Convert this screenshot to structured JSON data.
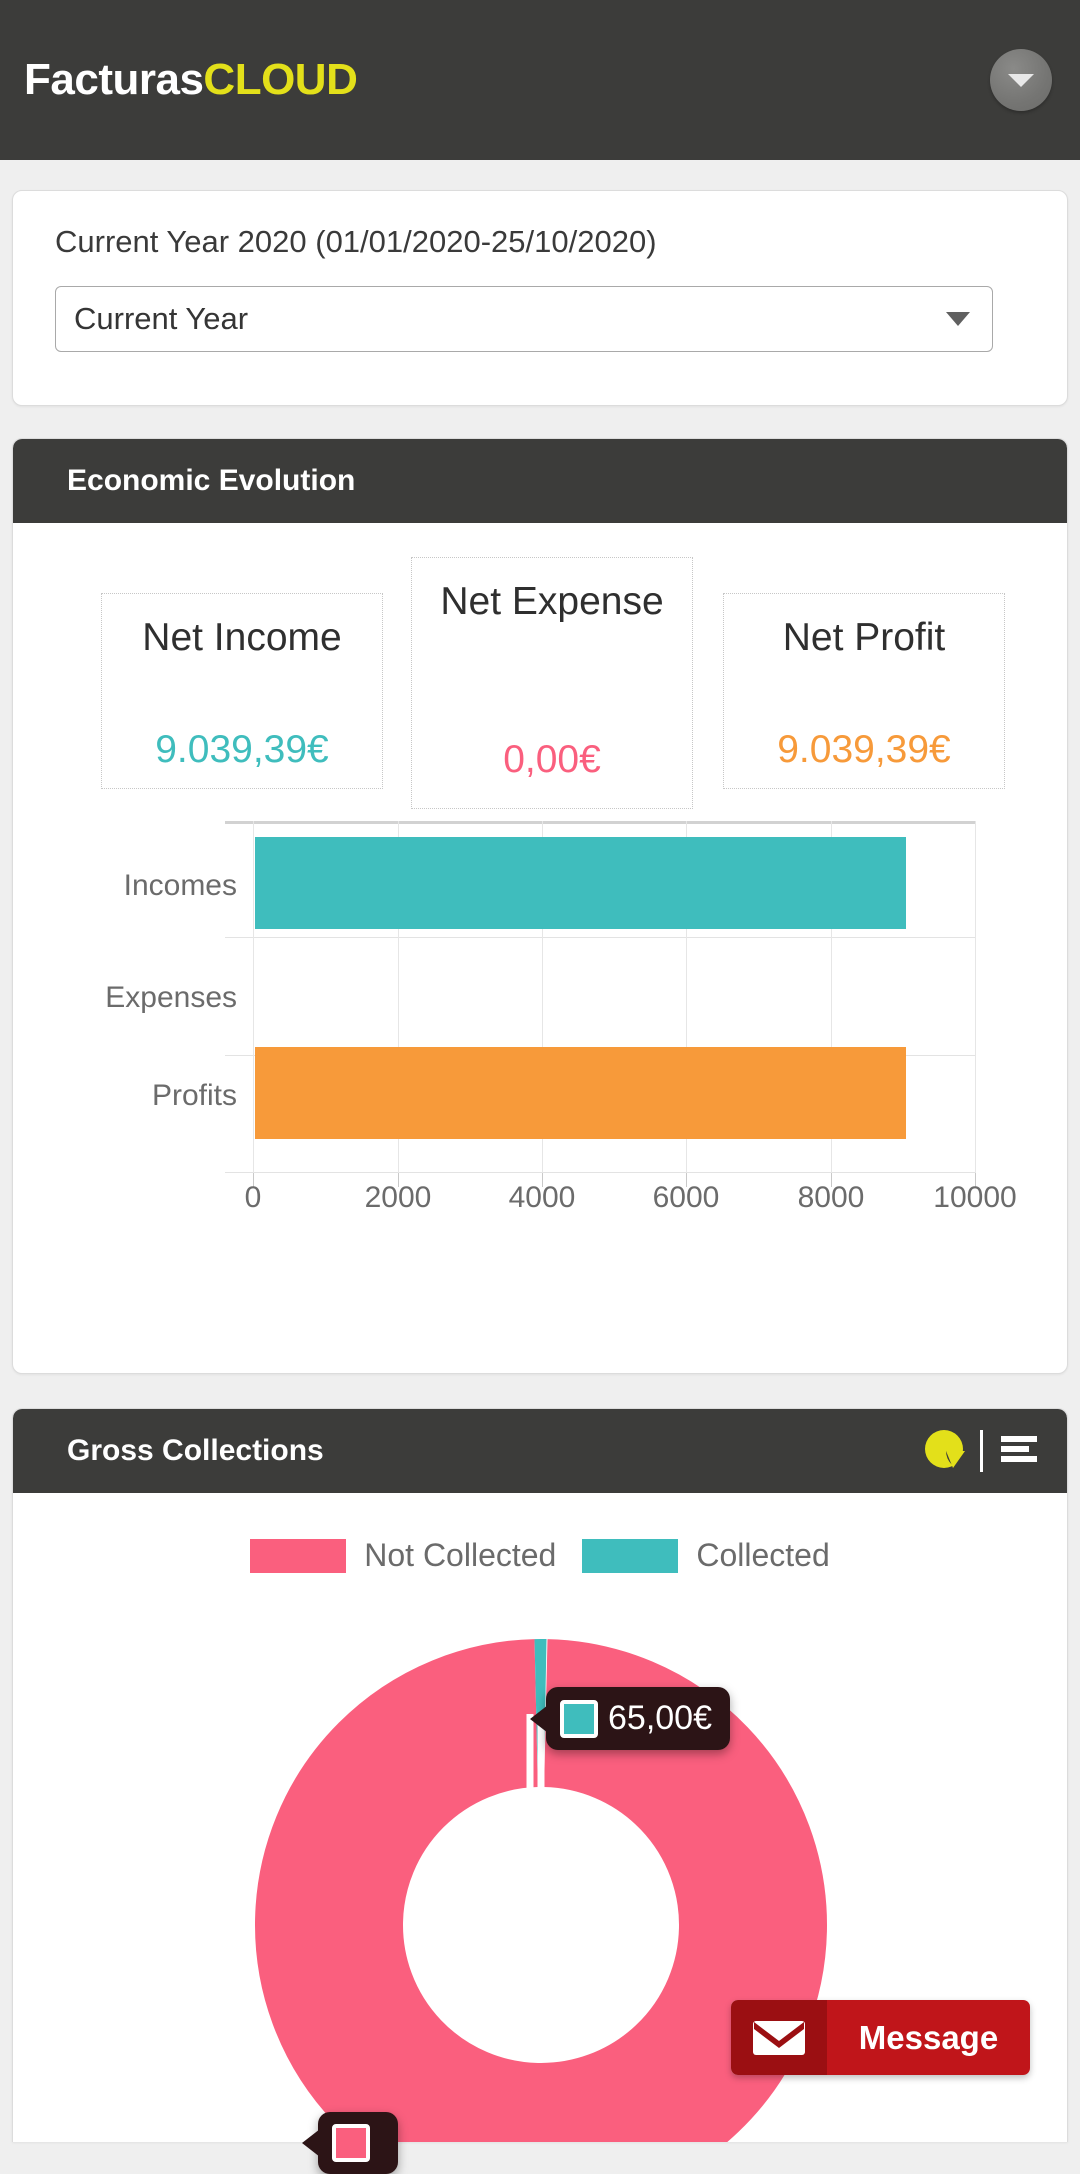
{
  "header": {
    "brand_first": "Facturas",
    "brand_second": "CLOUD",
    "brand_accent_color": "#e3e01a",
    "user_menu_icon": "chevron-down-icon"
  },
  "date_panel": {
    "range_label": "Current Year 2020 (01/01/2020-25/10/2020)",
    "period_selected": "Current Year"
  },
  "evolution_panel": {
    "title": "Economic Evolution",
    "kpis": [
      {
        "title": "Net Income",
        "value": "9.039,39€",
        "color": "#3fbdbd"
      },
      {
        "title": "Net Expense",
        "value": "0,00€",
        "color": "#fa5f7e"
      },
      {
        "title": "Net Profit",
        "value": "9.039,39€",
        "color": "#f79a3a"
      }
    ]
  },
  "gross_panel": {
    "title": "Gross Collections",
    "tools": [
      {
        "name": "pie-chart-icon",
        "active": true,
        "color": "#e3e01a"
      },
      {
        "name": "list-view-icon",
        "active": false,
        "color": "#ffffff"
      }
    ],
    "legend": [
      {
        "label": "Not Collected",
        "color": "#fa5f7e"
      },
      {
        "label": "Collected",
        "color": "#3fbdbd"
      }
    ],
    "tooltips": [
      {
        "value": "65,00€",
        "swatch_color": "#3fbdbd"
      },
      {
        "value": "",
        "swatch_color": "#fa5f7e"
      }
    ]
  },
  "message_button": {
    "label": "Message",
    "icon": "envelope-icon",
    "icon_bg": "#9b0f12",
    "body_bg": "#c0151a"
  },
  "chart_data": [
    {
      "type": "bar",
      "orientation": "horizontal",
      "title": "Economic Evolution",
      "categories": [
        "Incomes",
        "Expenses",
        "Profits"
      ],
      "values": [
        9039.39,
        0,
        9039.39
      ],
      "colors": [
        "#3fbdbd",
        "#ffffff",
        "#f79a3a"
      ],
      "xlabel": "",
      "ylabel": "",
      "xlim": [
        0,
        10000
      ],
      "xticks": [
        0,
        2000,
        4000,
        6000,
        8000,
        10000
      ],
      "xtick_labels": [
        "0",
        "2000",
        "4000",
        "6000",
        "8000",
        "10000"
      ],
      "grid": true,
      "legend": false
    },
    {
      "type": "pie",
      "variant": "donut",
      "title": "Gross Collections",
      "labels": [
        "Not Collected",
        "Collected"
      ],
      "values": [
        9039.39,
        65.0
      ],
      "colors": [
        "#fa5f7e",
        "#3fbdbd"
      ],
      "legend": true,
      "legend_position": "top"
    }
  ]
}
